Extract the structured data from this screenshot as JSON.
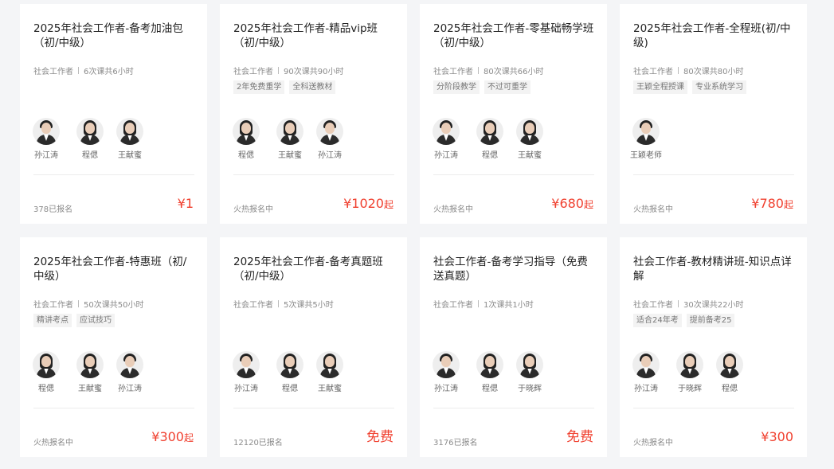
{
  "colors": {
    "price": "#f0402f",
    "background": "#f4f5f7"
  },
  "courses": [
    {
      "title": "2025年社会工作者-备考加油包（初/中级）",
      "category": "社会工作者",
      "lessons": "6次课共6小时",
      "tags": [],
      "teachers": [
        {
          "name": "孙江涛",
          "hair": "short"
        },
        {
          "name": "程偲",
          "hair": "long"
        },
        {
          "name": "王献蜜",
          "hair": "long"
        }
      ],
      "status": "378已报名",
      "price": "¥1",
      "suffix": ""
    },
    {
      "title": "2025年社会工作者-精品vip班（初/中级）",
      "category": "社会工作者",
      "lessons": "90次课共90小时",
      "tags": [
        "2年免费重学",
        "全科送教材"
      ],
      "teachers": [
        {
          "name": "程偲",
          "hair": "long"
        },
        {
          "name": "王献蜜",
          "hair": "long"
        },
        {
          "name": "孙江涛",
          "hair": "short"
        }
      ],
      "status": "火热报名中",
      "price": "¥1020",
      "suffix": "起"
    },
    {
      "title": "2025年社会工作者-零基础畅学班（初/中级）",
      "category": "社会工作者",
      "lessons": "80次课共66小时",
      "tags": [
        "分阶段教学",
        "不过可重学"
      ],
      "teachers": [
        {
          "name": "孙江涛",
          "hair": "short"
        },
        {
          "name": "程偲",
          "hair": "long"
        },
        {
          "name": "王献蜜",
          "hair": "long"
        }
      ],
      "status": "火热报名中",
      "price": "¥680",
      "suffix": "起"
    },
    {
      "title": "2025年社会工作者-全程班(初/中级)",
      "category": "社会工作者",
      "lessons": "80次课共80小时",
      "tags": [
        "王颖全程授课",
        "专业系统学习"
      ],
      "teachers": [
        {
          "name": "王颖老师",
          "hair": "short"
        }
      ],
      "status": "火热报名中",
      "price": "¥780",
      "suffix": "起"
    },
    {
      "title": "2025年社会工作者-特惠班（初/中级）",
      "category": "社会工作者",
      "lessons": "50次课共50小时",
      "tags": [
        "精讲考点",
        "应试技巧"
      ],
      "teachers": [
        {
          "name": "程偲",
          "hair": "long"
        },
        {
          "name": "王献蜜",
          "hair": "long"
        },
        {
          "name": "孙江涛",
          "hair": "short"
        }
      ],
      "status": "火热报名中",
      "price": "¥300",
      "suffix": "起"
    },
    {
      "title": "2025年社会工作者-备考真题班（初/中级）",
      "category": "社会工作者",
      "lessons": "5次课共5小时",
      "tags": [],
      "teachers": [
        {
          "name": "孙江涛",
          "hair": "short"
        },
        {
          "name": "程偲",
          "hair": "long"
        },
        {
          "name": "王献蜜",
          "hair": "long"
        }
      ],
      "status": "12120已报名",
      "price": "免费",
      "suffix": ""
    },
    {
      "title": "社会工作者-备考学习指导（免费送真题）",
      "category": "社会工作者",
      "lessons": "1次课共1小时",
      "tags": [],
      "teachers": [
        {
          "name": "孙江涛",
          "hair": "short"
        },
        {
          "name": "程偲",
          "hair": "long"
        },
        {
          "name": "于晓辉",
          "hair": "long"
        }
      ],
      "status": "3176已报名",
      "price": "免费",
      "suffix": ""
    },
    {
      "title": "社会工作者-教材精讲班-知识点详解",
      "category": "社会工作者",
      "lessons": "30次课共22小时",
      "tags": [
        "适合24年考",
        "提前备考25"
      ],
      "teachers": [
        {
          "name": "孙江涛",
          "hair": "short"
        },
        {
          "name": "于晓辉",
          "hair": "long"
        },
        {
          "name": "程偲",
          "hair": "long"
        }
      ],
      "status": "火热报名中",
      "price": "¥300",
      "suffix": ""
    }
  ]
}
